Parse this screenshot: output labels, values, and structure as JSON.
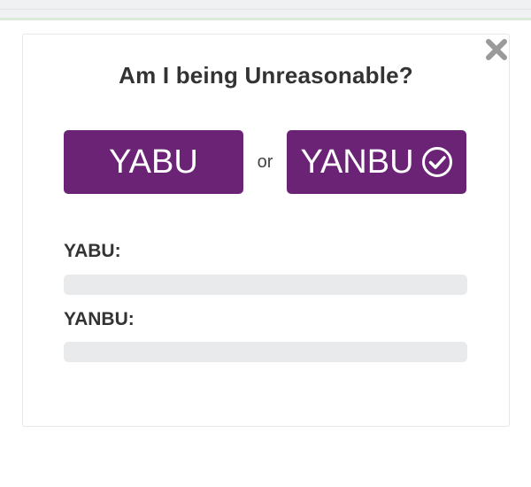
{
  "dialog": {
    "title": "Am I being Unreasonable?",
    "close_icon": "close-x-icon",
    "accent_color": "#6b2376"
  },
  "vote": {
    "yabu_label": "YABU",
    "or_label": "or",
    "yanbu_label": "YANBU",
    "yanbu_icon": "check-circle-icon",
    "selected": "YANBU"
  },
  "results": [
    {
      "label": "YABU:",
      "progress": 0
    },
    {
      "label": "YANBU:",
      "progress": 0
    }
  ]
}
